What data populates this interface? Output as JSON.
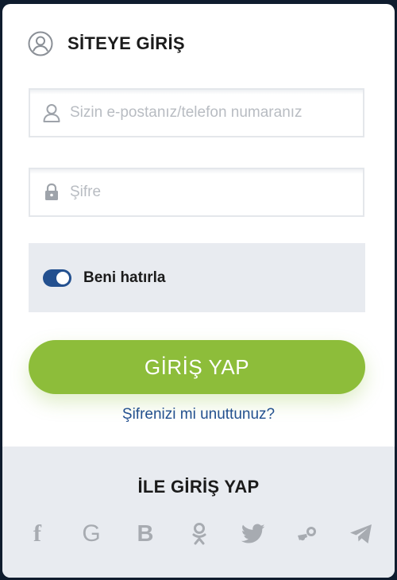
{
  "header": {
    "title": "SİTEYE GİRİŞ",
    "icon": "user-circle-icon"
  },
  "form": {
    "email": {
      "placeholder": "Sizin e-postanız/telefon numaranız",
      "value": "",
      "icon": "user-icon"
    },
    "password": {
      "placeholder": "Şifre",
      "value": "",
      "icon": "lock-icon"
    },
    "remember": {
      "label": "Beni hatırla",
      "checked": true
    },
    "submit_label": "GİRİŞ YAP",
    "forgot_link": "Şifrenizi mi unuttunuz?"
  },
  "social": {
    "title": "İLE GİRİŞ YAP",
    "providers": [
      {
        "name": "facebook",
        "icon": "facebook-icon",
        "glyph": "f"
      },
      {
        "name": "google",
        "icon": "google-icon",
        "glyph": "G"
      },
      {
        "name": "vkontakte",
        "icon": "b-icon",
        "glyph": "B"
      },
      {
        "name": "odnoklassniki",
        "icon": "odnoklassniki-icon"
      },
      {
        "name": "twitter",
        "icon": "twitter-icon"
      },
      {
        "name": "steam",
        "icon": "steam-icon"
      },
      {
        "name": "telegram",
        "icon": "telegram-icon"
      }
    ]
  },
  "colors": {
    "accent_green": "#8dbd3a",
    "accent_blue": "#23508f",
    "panel_gray": "#e8ebf0",
    "icon_gray": "#a7abb1",
    "backdrop": "#0f1c2e"
  }
}
